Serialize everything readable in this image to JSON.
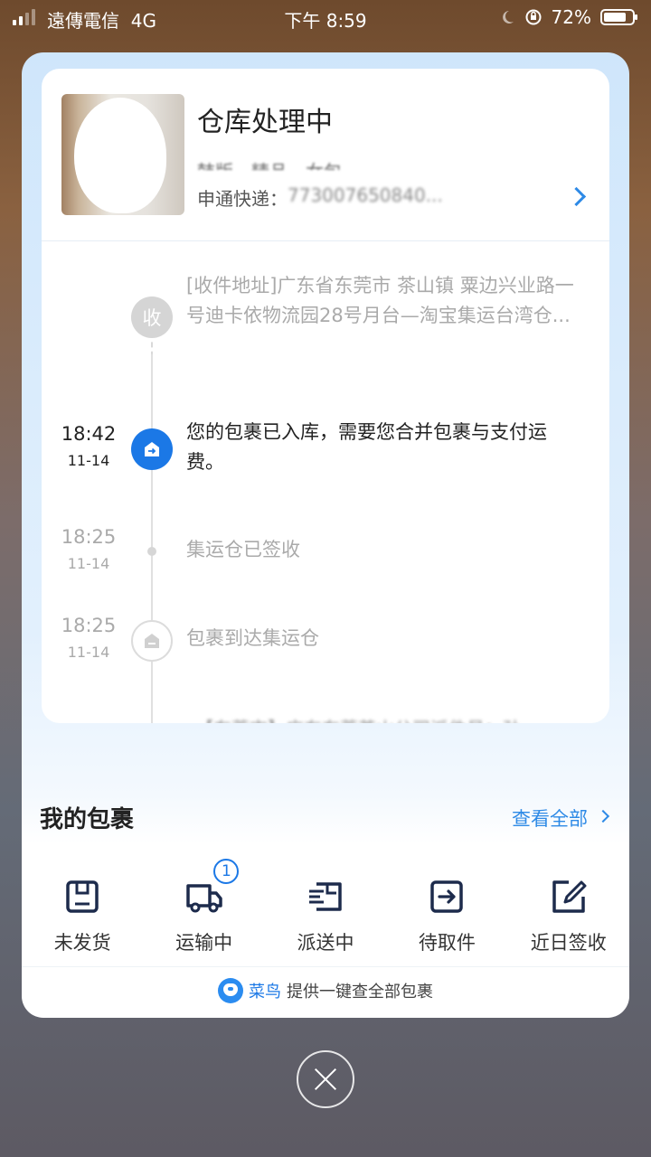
{
  "status_bar": {
    "carrier": "遠傳電信",
    "network": "4G",
    "time": "下午 8:59",
    "battery": "72%"
  },
  "shipment": {
    "title": "仓库处理中",
    "subtitle": "韩版…精品…女包…",
    "courier_label": "申通快递：",
    "tracking_number": "773007650840..."
  },
  "timeline": [
    {
      "icon": "收",
      "text": "[收件地址]广东省东莞市 茶山镇  粟边兴业路一号迪卡依物流园28号月台—淘宝集运台湾仓...",
      "time": "",
      "date": ""
    },
    {
      "icon": "warehouse-arrow-icon",
      "text": "您的包裹已入库，需要您合并包裹与支付运费。",
      "time": "18:42",
      "date": "11-14"
    },
    {
      "icon": "dot",
      "text": "集运仓已签收",
      "time": "18:25",
      "date": "11-14"
    },
    {
      "icon": "warehouse-icon",
      "text": "包裹到达集运仓",
      "time": "18:25",
      "date": "11-14"
    }
  ],
  "timeline_more": "【东莞市】广东东莞茶山公司派件员：孙",
  "my_packages": {
    "title": "我的包裹",
    "view_all": "查看全部",
    "categories": [
      {
        "label": "未发货",
        "icon": "box-icon",
        "badge": ""
      },
      {
        "label": "运输中",
        "icon": "truck-icon",
        "badge": "1"
      },
      {
        "label": "派送中",
        "icon": "delivery-icon",
        "badge": ""
      },
      {
        "label": "待取件",
        "icon": "pickup-icon",
        "badge": ""
      },
      {
        "label": "近日签收",
        "icon": "signed-icon",
        "badge": ""
      }
    ]
  },
  "footer": {
    "brand": "菜鸟",
    "text": "提供一键查全部包裹"
  },
  "colors": {
    "accent": "#1b78e6",
    "link": "#2e8ae6"
  }
}
